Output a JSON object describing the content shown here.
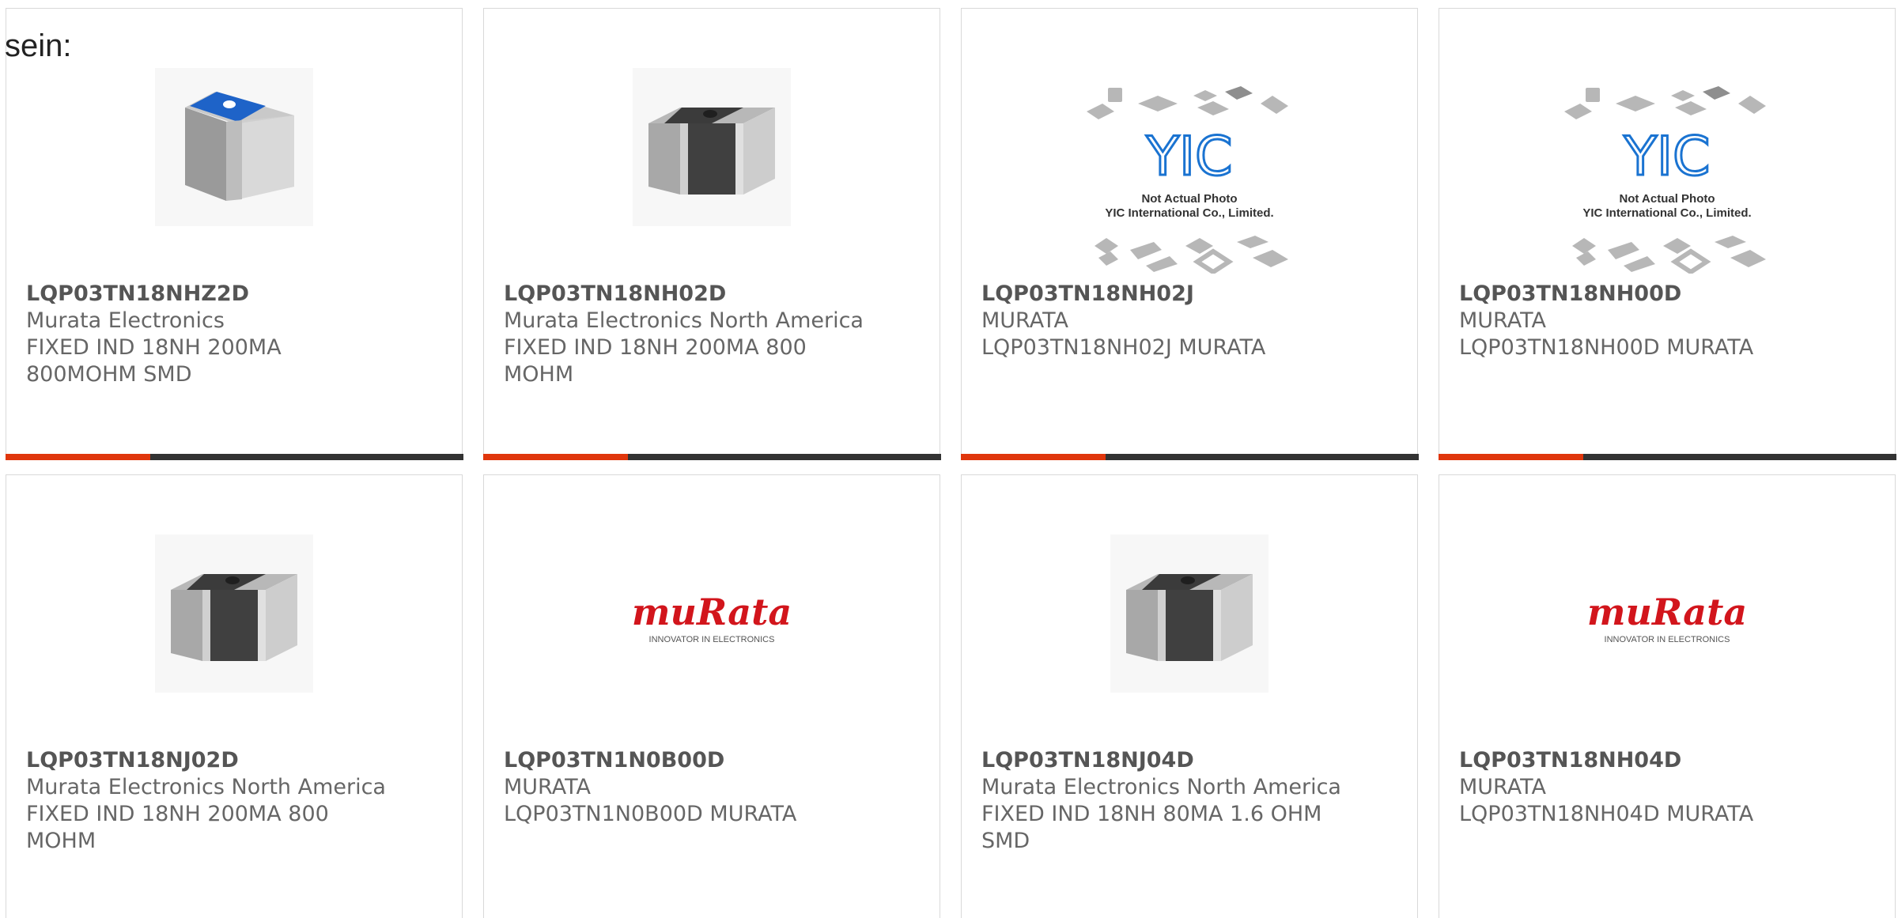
{
  "intro_text": "sein:",
  "colors": {
    "accent": "#e0360c",
    "bar_dark": "#333333",
    "text": "#666666",
    "card_border": "#d9d9d9"
  },
  "products": [
    {
      "part_number": "LQP03TN18NHZ2D",
      "manufacturer": "Murata Electronics",
      "description": "FIXED IND 18NH 200MA 800MOHM SMD",
      "image": "chip-inductor-blue-top"
    },
    {
      "part_number": "LQP03TN18NH02D",
      "manufacturer": "Murata Electronics North America",
      "description": "FIXED IND 18NH 200MA 800 MOHM",
      "image": "chip-inductor-dark"
    },
    {
      "part_number": "LQP03TN18NH02J",
      "manufacturer": "MURATA",
      "description": "LQP03TN18NH02J MURATA",
      "image": "yic-placeholder",
      "image_text": [
        "Not Actual Photo",
        "YIC International Co., Limited."
      ],
      "image_logo": "YIC"
    },
    {
      "part_number": "LQP03TN18NH00D",
      "manufacturer": "MURATA",
      "description": "LQP03TN18NH00D MURATA",
      "image": "yic-placeholder",
      "image_text": [
        "Not Actual Photo",
        "YIC International Co., Limited."
      ],
      "image_logo": "YIC"
    },
    {
      "part_number": "LQP03TN18NJ02D",
      "manufacturer": "Murata Electronics North America",
      "description": "FIXED IND 18NH 200MA 800 MOHM",
      "image": "chip-inductor-dark"
    },
    {
      "part_number": "LQP03TN1N0B00D",
      "manufacturer": "MURATA",
      "description": "LQP03TN1N0B00D MURATA",
      "image": "murata-logo",
      "image_logo": "muRata",
      "image_tagline": "INNOVATOR IN ELECTRONICS"
    },
    {
      "part_number": "LQP03TN18NJ04D",
      "manufacturer": "Murata Electronics North America",
      "description": "FIXED IND 18NH 80MA 1.6 OHM SMD",
      "image": "chip-inductor-dark"
    },
    {
      "part_number": "LQP03TN18NH04D",
      "manufacturer": "MURATA",
      "description": "LQP03TN18NH04D MURATA",
      "image": "murata-logo",
      "image_logo": "muRata",
      "image_tagline": "INNOVATOR IN ELECTRONICS"
    }
  ]
}
